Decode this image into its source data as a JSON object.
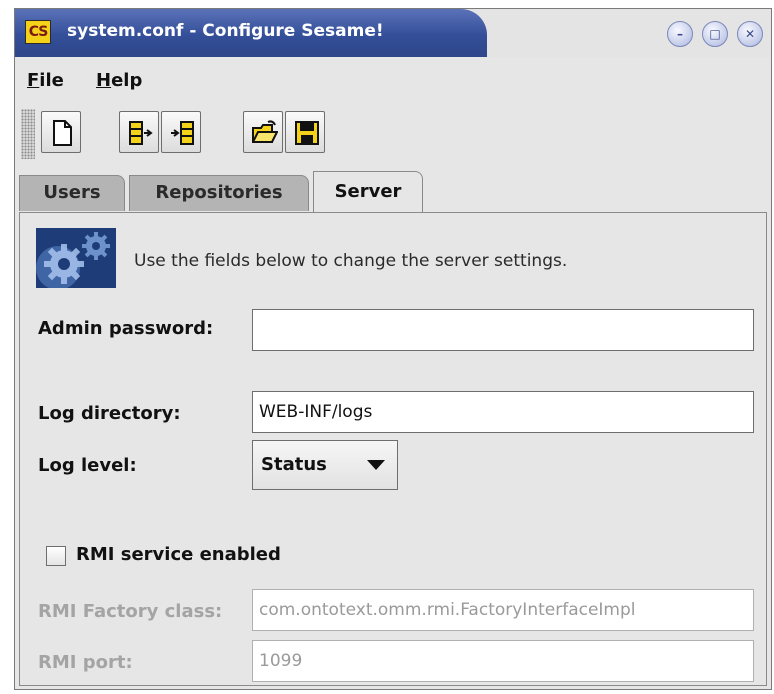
{
  "window": {
    "icon_text": "CS",
    "title": "system.conf - Configure Sesame!",
    "buttons": {
      "minimize": "–",
      "maximize": "□",
      "close": "✕"
    }
  },
  "menu": [
    {
      "mnemonic": "F",
      "rest": "ile"
    },
    {
      "mnemonic": "H",
      "rest": "elp"
    }
  ],
  "toolbar": {
    "buttons": [
      "new-document-icon",
      "export-repository-icon",
      "import-repository-icon",
      "open-folder-icon",
      "save-disk-icon"
    ]
  },
  "tabs": [
    {
      "label": "Users",
      "active": false
    },
    {
      "label": "Repositories",
      "active": false
    },
    {
      "label": "Server",
      "active": true
    }
  ],
  "server": {
    "intro": "Use the fields below to change the server settings.",
    "admin_password": {
      "label": "Admin password:",
      "value": ""
    },
    "log_directory": {
      "label": "Log directory:",
      "value": "WEB-INF/logs"
    },
    "log_level": {
      "label": "Log level:",
      "value": "Status"
    },
    "rmi_enabled": {
      "label": "RMI service enabled",
      "checked": false
    },
    "rmi_factory_class": {
      "label": "RMI Factory class:",
      "value": "com.ontotext.omm.rmi.FactoryInterfaceImpl",
      "enabled": false
    },
    "rmi_port": {
      "label": "RMI port:",
      "value": "1099",
      "enabled": false
    }
  },
  "colors": {
    "title_bar": "#344f99",
    "toolbar_icon_yellow": "#f5d21a",
    "disabled_text": "#a4a4a4"
  }
}
